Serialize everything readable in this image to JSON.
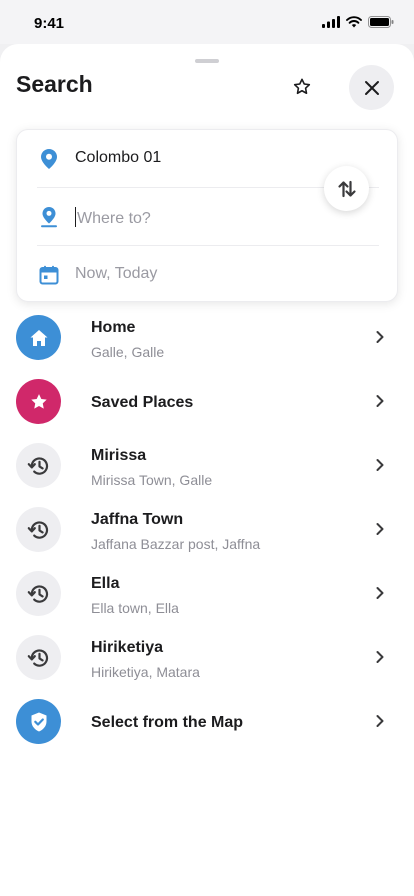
{
  "status_bar": {
    "time": "9:41"
  },
  "header": {
    "title": "Search",
    "favorite_icon": "star-outline-icon",
    "close_icon": "close-icon"
  },
  "route": {
    "origin": {
      "value": "Colombo 01",
      "icon": "location-pin-icon"
    },
    "destination": {
      "value": "",
      "placeholder": "Where to?",
      "icon": "location-pin-drop-icon"
    },
    "time": {
      "value": "",
      "placeholder": "Now, Today",
      "icon": "calendar-icon"
    },
    "swap_icon": "swap-vertical-icon"
  },
  "places": [
    {
      "name": "Home",
      "subtitle": "Galle, Galle",
      "icon": "home-icon",
      "avatar_color": "#3d8fd6",
      "icon_color": "#ffffff"
    },
    {
      "name": "Saved Places",
      "subtitle": "",
      "icon": "star-icon",
      "avatar_color": "#d0286a",
      "icon_color": "#ffffff"
    },
    {
      "name": "Mirissa",
      "subtitle": "Mirissa Town, Galle",
      "icon": "history-icon",
      "avatar_color": "#eeeef1",
      "icon_color": "#3a3a3c"
    },
    {
      "name": "Jaffna Town",
      "subtitle": "Jaffana Bazzar post, Jaffna",
      "icon": "history-icon",
      "avatar_color": "#eeeef1",
      "icon_color": "#3a3a3c"
    },
    {
      "name": "Ella",
      "subtitle": "Ella town, Ella",
      "icon": "history-icon",
      "avatar_color": "#eeeef1",
      "icon_color": "#3a3a3c"
    },
    {
      "name": "Hiriketiya",
      "subtitle": "Hiriketiya, Matara",
      "icon": "history-icon",
      "avatar_color": "#eeeef1",
      "icon_color": "#3a3a3c"
    },
    {
      "name": "Select from the Map",
      "subtitle": "",
      "icon": "map-check-icon",
      "avatar_color": "#3d8fd6",
      "icon_color": "#ffffff"
    }
  ],
  "colors": {
    "accent": "#3d8fd6",
    "saved": "#d0286a",
    "subtitle": "#8e8e96"
  }
}
